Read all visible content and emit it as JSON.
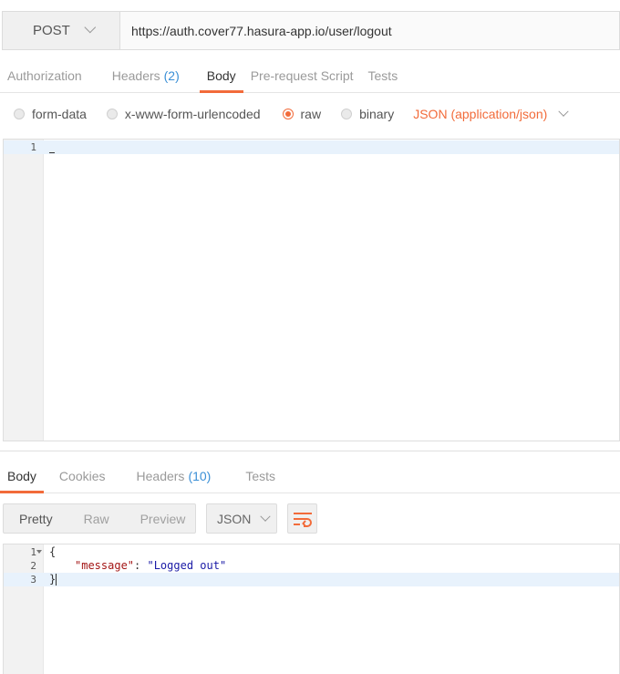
{
  "request": {
    "method": "POST",
    "url": "https://auth.cover77.hasura-app.io/user/logout"
  },
  "request_tabs": [
    {
      "label": "Authorization",
      "count": ""
    },
    {
      "label": "Headers",
      "count": "(2)"
    },
    {
      "label": "Body",
      "count": ""
    },
    {
      "label": "Pre-request Script",
      "count": ""
    },
    {
      "label": "Tests",
      "count": ""
    }
  ],
  "body_options": {
    "form_data": "form-data",
    "urlencoded": "x-www-form-urlencoded",
    "raw": "raw",
    "binary": "binary",
    "content_type": "JSON (application/json)",
    "selected": "raw"
  },
  "request_editor": {
    "lines": [
      {
        "num": "1",
        "text": ""
      }
    ]
  },
  "response_tabs": [
    {
      "label": "Body",
      "count": ""
    },
    {
      "label": "Cookies",
      "count": ""
    },
    {
      "label": "Headers",
      "count": "(10)"
    },
    {
      "label": "Tests",
      "count": ""
    }
  ],
  "response_toolbar": {
    "views": [
      "Pretty",
      "Raw",
      "Preview"
    ],
    "active_view": "Pretty",
    "format": "JSON"
  },
  "response_editor": {
    "lines": [
      {
        "num": "1",
        "text": "{"
      },
      {
        "num": "2",
        "key": "\"message\"",
        "sep": ": ",
        "value": "\"Logged out\""
      },
      {
        "num": "3",
        "text": "}"
      }
    ]
  },
  "colors": {
    "accent": "#f26b3a",
    "count_blue": "#3a8fd6"
  }
}
